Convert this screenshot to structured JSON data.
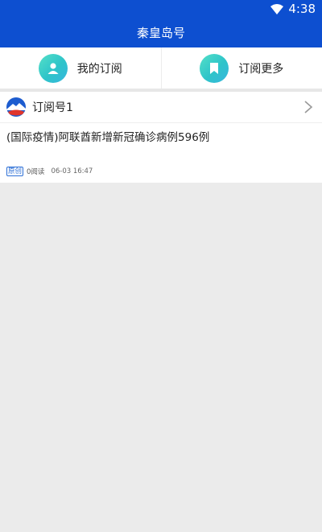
{
  "status": {
    "time": "4:38"
  },
  "header": {
    "title": "秦皇岛号"
  },
  "tabs": [
    {
      "label": "我的订阅",
      "icon": "person-icon"
    },
    {
      "label": "订阅更多",
      "icon": "bookmark-icon"
    }
  ],
  "channel": {
    "name": "订阅号1"
  },
  "article": {
    "title": "(国际疫情)阿联酋新增新冠确诊病例596例",
    "badge": "原创",
    "reads": "0阅读",
    "date": "06-03 16:47"
  },
  "colors": {
    "brand": "#0d4fd0",
    "accent": "#2ec4c9"
  }
}
